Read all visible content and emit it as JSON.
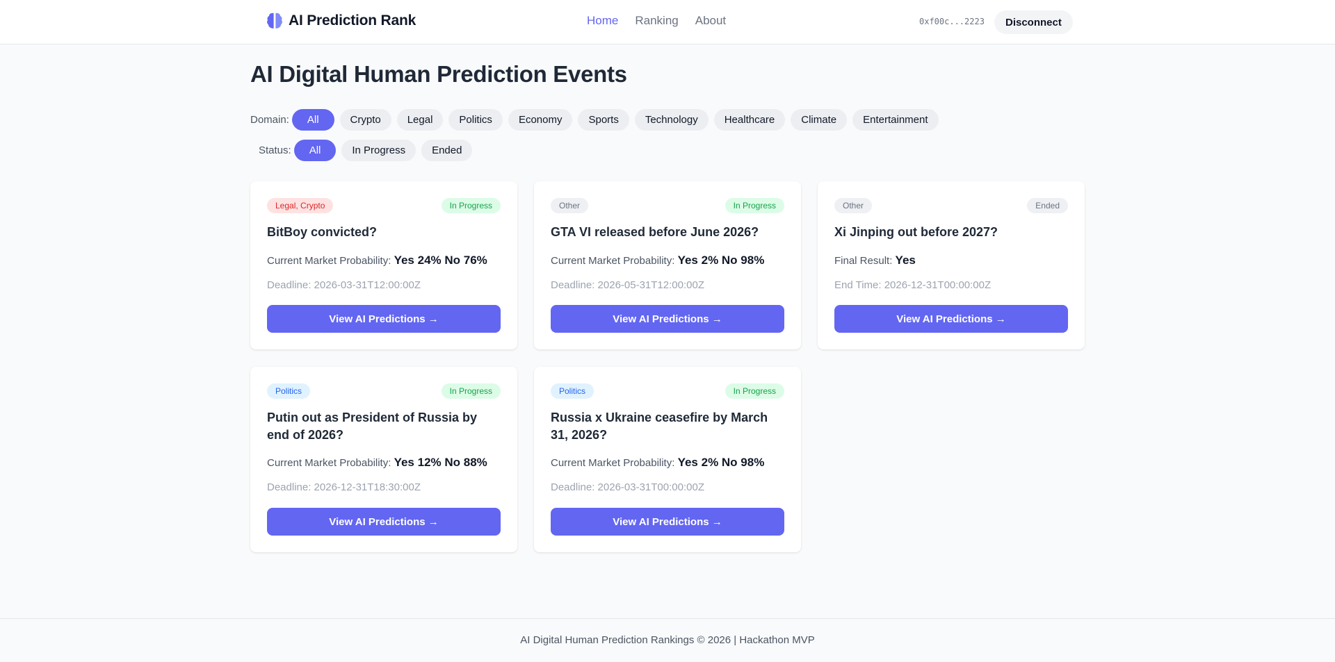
{
  "header": {
    "brand": "AI Prediction Rank",
    "nav": [
      {
        "label": "Home",
        "active": true
      },
      {
        "label": "Ranking",
        "active": false
      },
      {
        "label": "About",
        "active": false
      }
    ],
    "wallet_address": "0xf00c...2223",
    "disconnect_label": "Disconnect"
  },
  "main": {
    "title": "AI Digital Human Prediction Events",
    "domain_filter": {
      "label": "Domain:",
      "options": [
        "All",
        "Crypto",
        "Legal",
        "Politics",
        "Economy",
        "Sports",
        "Technology",
        "Healthcare",
        "Climate",
        "Entertainment"
      ],
      "selected": "All"
    },
    "status_filter": {
      "label": "Status:",
      "options": [
        "All",
        "In Progress",
        "Ended"
      ],
      "selected": "All"
    },
    "events": [
      {
        "tag": "Legal, Crypto",
        "status": "In Progress",
        "title": "BitBoy convicted?",
        "prob_label": "Current Market Probability:",
        "prob_value": "Yes 24% No 76%",
        "deadline": "Deadline: 2026-03-31T12:00:00Z",
        "cta": "View AI Predictions →"
      },
      {
        "tag": "Other",
        "status": "In Progress",
        "title": "GTA VI released before June 2026?",
        "prob_label": "Current Market Probability:",
        "prob_value": "Yes 2% No 98%",
        "deadline": "Deadline: 2026-05-31T12:00:00Z",
        "cta": "View AI Predictions →"
      },
      {
        "tag": "Other",
        "status": "Ended",
        "title": "Xi Jinping out before 2027?",
        "prob_label": "Final Result:",
        "prob_value": "Yes",
        "deadline": "End Time: 2026-12-31T00:00:00Z",
        "cta": "View AI Predictions →"
      },
      {
        "tag": "Politics",
        "status": "In Progress",
        "title": "Putin out as President of Russia by end of 2026?",
        "prob_label": "Current Market Probability:",
        "prob_value": "Yes 12% No 88%",
        "deadline": "Deadline: 2026-12-31T18:30:00Z",
        "cta": "View AI Predictions →"
      },
      {
        "tag": "Politics",
        "status": "In Progress",
        "title": "Russia x Ukraine ceasefire by March 31, 2026?",
        "prob_label": "Current Market Probability:",
        "prob_value": "Yes 2% No 98%",
        "deadline": "Deadline: 2026-03-31T00:00:00Z",
        "cta": "View AI Predictions →"
      }
    ]
  },
  "footer": {
    "text": "AI Digital Human Prediction Rankings © 2026 | Hackathon MVP"
  },
  "colors": {
    "accent": "#6366f1",
    "in_progress_bg": "#dcfce7",
    "in_progress_text": "#16a34a",
    "tag_red_bg": "#fee2e2",
    "tag_blue_bg": "#e0f2fe"
  }
}
